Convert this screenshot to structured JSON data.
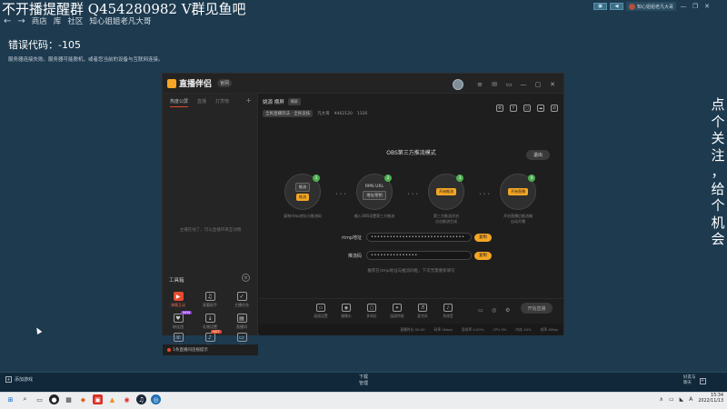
{
  "overlay": {
    "title": "不开播提醒群  Q454280982 V群见鱼吧",
    "vertical_text": [
      "点",
      "个",
      "关",
      "注",
      "，",
      "给",
      "个",
      "机",
      "会"
    ]
  },
  "nav": {
    "back_icon": "←",
    "forward_icon": "→",
    "items": [
      "商店",
      "库",
      "社区",
      "知心姐姐老凡大哥"
    ]
  },
  "topbar": {
    "buttons": [
      "▣",
      "◀"
    ],
    "user_name": "知心姐姐老凡大哥",
    "window_controls": [
      "—",
      "❐",
      "✕"
    ]
  },
  "error": {
    "title": "错误代码：-105",
    "detail": "服务器连接失败。服务器可能脱机，或者您当前的设备与互联网连接。"
  },
  "app": {
    "name": "直播伴侣",
    "version_badge": "官网",
    "header_icons": [
      "≡",
      "✉",
      "▭",
      "—",
      "▢",
      "✕"
    ],
    "left_tabs": [
      "热度公屏",
      "直播",
      "打赏榜"
    ],
    "left_plus": "+",
    "left_empty_text": "主播在线了，可以直播带来互动哦",
    "tools_label": "工具箱",
    "tools_toggle": "≡",
    "tools": [
      {
        "label": "弹幕互动",
        "icon": "▶",
        "red": true
      },
      {
        "label": "观看助手",
        "icon": "♫",
        "red": false
      },
      {
        "label": "主播任务",
        "icon": "✓",
        "red": false
      },
      {
        "label": "粉丝团",
        "icon": "♥",
        "red": false
      },
      {
        "label": "礼物设置",
        "icon": "↓",
        "red": false
      },
      {
        "label": "直播间",
        "icon": "▤",
        "red": false
      },
      {
        "label": "连线",
        "icon": "☏",
        "red": false
      },
      {
        "label": "音效",
        "icon": "♪",
        "red": false
      },
      {
        "label": "投屏",
        "icon": "▭",
        "red": false
      },
      {
        "label": "",
        "icon": "✦",
        "red": false
      },
      {
        "label": "",
        "icon": "▣",
        "red": false
      },
      {
        "label": "",
        "icon": "↓",
        "red": false
      }
    ],
    "badges": {
      "tool4": "NEW",
      "tool10": "HOT"
    },
    "left_footer": "1条直播间违规提示"
  },
  "stream": {
    "title": "姚源 横屏 ",
    "title_chip": "横屏",
    "category": "全民直播玩法 · 全民竞技",
    "room": "凡大哥",
    "fans": "¥462120",
    "online": "1326",
    "icons": [
      "⚙",
      "↑",
      "▢",
      "☁",
      "⇄"
    ]
  },
  "obs": {
    "title": "OBS第三方推流模式",
    "exit": "退出",
    "steps": [
      {
        "num": "1",
        "pill1": "推流",
        "pill2": "推流",
        "desc": "复制rtmp地址与推流码"
      },
      {
        "num": "2",
        "top": "RMS URL",
        "pill": "地址/密钥",
        "desc": "输入OBS设置第三方推流"
      },
      {
        "num": "3",
        "pill": "开始推流",
        "desc": "第三方推流开启\n点击推流生成"
      },
      {
        "num": "4",
        "pill": "开始直播",
        "desc": "开启直播后推流端\n自动开播"
      }
    ],
    "connector": "• • •",
    "rtmp_label": "rtmp地址",
    "rtmp_value": "••••••••••••••••••••••••••••••",
    "key_label": "推流码",
    "key_value": "•••••••••••••••",
    "copy": "复制",
    "hint": "推荐在rtmp地址与推流码框，下次无需重新填写"
  },
  "bottom_tools": [
    {
      "label": "画面设置",
      "icon": "▭"
    },
    {
      "label": "摄像头",
      "icon": "◉"
    },
    {
      "label": "多机位",
      "icon": "▢"
    },
    {
      "label": "画面特效",
      "icon": "✦"
    },
    {
      "label": "麦克风",
      "icon": "♬"
    },
    {
      "label": "系统音",
      "icon": "♪"
    }
  ],
  "bottom_right_icons": [
    "▭",
    "◎",
    "⚙"
  ],
  "start_button": "开始直播",
  "status": [
    "直播时长 00:00",
    "码率 0kbps",
    "丢帧率 0.00%",
    "CPU 9%",
    "内存 40%",
    "帧率 60fps"
  ],
  "steam_bottom": {
    "left": "添加游戏",
    "center_line1": "下载",
    "center_line2": "管理",
    "right_line1": "好友与",
    "right_line2": "聊天"
  },
  "taskbar": {
    "icons": [
      "⊞",
      "⌕",
      "▭",
      "●",
      "▦",
      "◆",
      "▣",
      "▲",
      "◉",
      "♫",
      "◎"
    ],
    "tray": [
      "∧",
      "▭",
      "◣",
      "A"
    ],
    "time": "15:34",
    "date": "2022/11/13"
  }
}
